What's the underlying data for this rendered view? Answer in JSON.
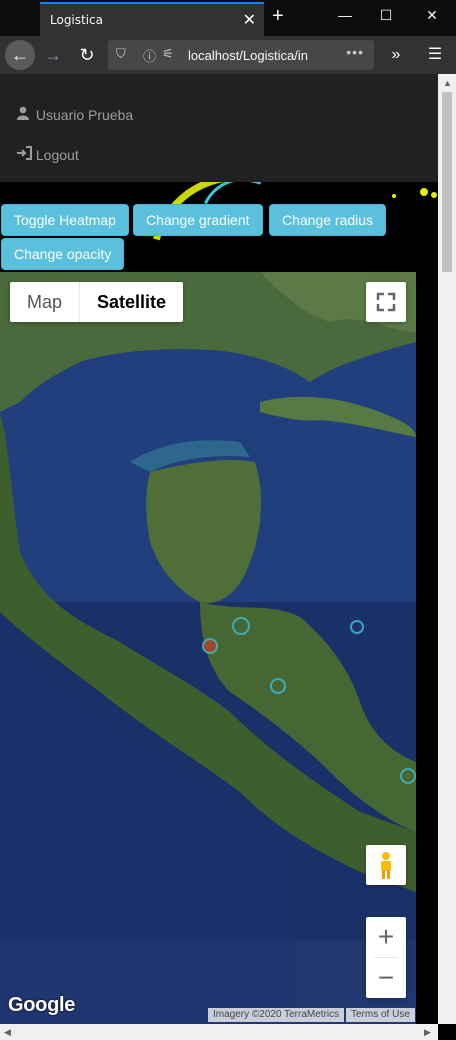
{
  "browser": {
    "tab_title": "Logistica",
    "url": "localhost/Logistica/in",
    "close_glyph": "✕",
    "new_tab_glyph": "+",
    "minimize_glyph": "—",
    "maximize_glyph": "☐",
    "window_close_glyph": "✕"
  },
  "user": {
    "name": "Usuario Prueba",
    "logout": "Logout"
  },
  "buttons": {
    "toggle_heatmap": "Toggle Heatmap",
    "change_gradient": "Change gradient",
    "change_radius": "Change radius",
    "change_opacity": "Change opacity"
  },
  "map": {
    "type_map": "Map",
    "type_satellite": "Satellite",
    "selected_type": "Satellite",
    "logo": "Google",
    "imagery": "Imagery ©2020 TerraMetrics",
    "terms": "Terms of Use",
    "zoom_in": "+",
    "zoom_out": "−"
  },
  "colors": {
    "info_button": "#5bc0de",
    "navbar": "#212121",
    "ocean": "#1d3a77",
    "land": "#3d5a2a"
  }
}
